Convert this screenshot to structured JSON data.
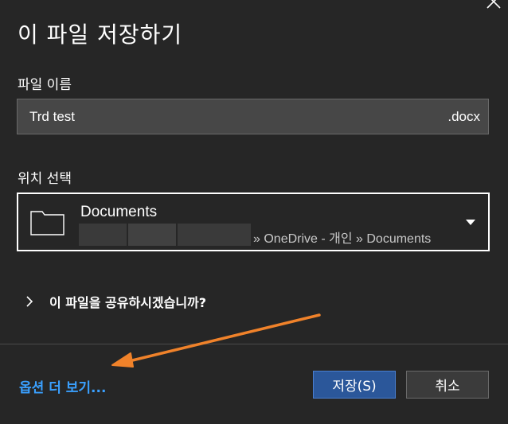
{
  "dialog": {
    "title": "이 파일 저장하기",
    "filename_label": "파일 이름",
    "filename_value": "Trd test",
    "extension": ".docx",
    "location_label": "위치 선택",
    "location": {
      "name": "Documents",
      "path": "» OneDrive - 개인 » Documents"
    },
    "share_prompt": "이 파일을 공유하시겠습니까?",
    "more_options": "옵션 더 보기...",
    "save_button": "저장(S)",
    "cancel_button": "취소"
  },
  "icons": {
    "close": "close-icon",
    "folder": "folder-icon",
    "dropdown": "dropdown-triangle-icon",
    "expand": "chevron-right-icon",
    "annotation": "orange-arrow-annotation"
  },
  "colors": {
    "background": "#262626",
    "accent_link": "#3aa0ff",
    "primary_button": "#2b579a",
    "annotation_arrow": "#f0822a"
  }
}
